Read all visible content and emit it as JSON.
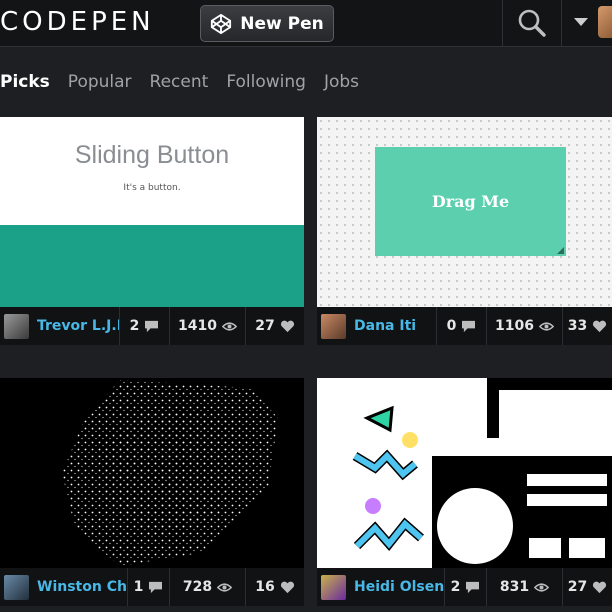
{
  "header": {
    "logo_text": "CODEPEN",
    "new_pen_label": "New Pen",
    "search_icon": "search-icon",
    "menu_icon": "caret-down-icon"
  },
  "tabs": [
    "Picks",
    "Popular",
    "Recent",
    "Following",
    "Jobs"
  ],
  "active_tab": "Picks",
  "cards": [
    {
      "preview": {
        "title": "Sliding Button",
        "subtitle": "It's a button."
      },
      "author": "Trevor L.J.M.",
      "comments": "2",
      "views": "1410",
      "hearts": "27"
    },
    {
      "preview": {
        "button_text": "Drag Me"
      },
      "author": "Dana Iti",
      "comments": "0",
      "views": "1106",
      "hearts": "33"
    },
    {
      "author": "Winston Chow",
      "comments": "1",
      "views": "728",
      "hearts": "16"
    },
    {
      "author": "Heidi Olsen",
      "comments": "2",
      "views": "831",
      "hearts": "27"
    }
  ],
  "colors": {
    "background": "#1e1f22",
    "username": "#48b8e6",
    "sliding_button_band": "#1aa188",
    "drag_box": "#5bcfae"
  }
}
